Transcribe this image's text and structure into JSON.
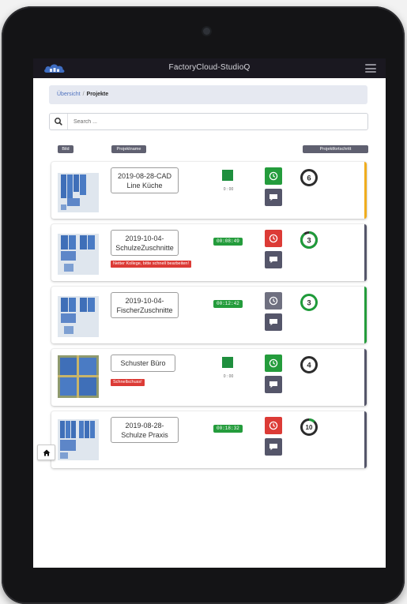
{
  "app": {
    "title": "FactoryCloud-StudioQ"
  },
  "breadcrumb": {
    "overview": "Übersicht",
    "separator": "/",
    "current": "Projekte"
  },
  "search": {
    "placeholder": "Search ..."
  },
  "columns": {
    "image": "Bild",
    "project_name": "Projektname",
    "progress": "Projektfortschritt"
  },
  "colors": {
    "green": "#249c3c",
    "red": "#dc3b36",
    "orange": "#f0ad1e",
    "slate": "#55566a",
    "gray": "#6f7080"
  },
  "projects": [
    {
      "name": "2019-08-28-CAD Line Küche",
      "status_mode": "square",
      "status_text": "0 : 00",
      "clock_color": "green",
      "accent": "orange",
      "progress_number": "6",
      "progress_fraction": 0.0,
      "note": ""
    },
    {
      "name": "2019-10-04-SchulzeZuschnitte",
      "status_mode": "timer",
      "timer": "00:08:49",
      "clock_color": "red",
      "accent": "slate",
      "progress_number": "3",
      "progress_fraction": 0.85,
      "note": "Netter Kollege, bitte schnell bearbeiten!"
    },
    {
      "name": "2019-10-04-FischerZuschnitte",
      "status_mode": "timer",
      "timer": "00:12:42",
      "clock_color": "gray",
      "accent": "green",
      "progress_number": "3",
      "progress_fraction": 1.0,
      "note": ""
    },
    {
      "name": "Schuster Büro",
      "status_mode": "square",
      "status_text": "0 : 00",
      "clock_color": "green",
      "accent": "slate",
      "progress_number": "4",
      "progress_fraction": 0.0,
      "note": "Schnellschuss!"
    },
    {
      "name": "2019-08-28-Schulze Praxis",
      "status_mode": "timer",
      "timer": "00:18:32",
      "clock_color": "red",
      "accent": "slate",
      "progress_number": "10",
      "progress_fraction": 0.12,
      "note": ""
    }
  ],
  "icons": {
    "logo": "cloud-logo",
    "menu": "hamburger-icon",
    "search": "search-icon",
    "clock": "clock-icon",
    "chat": "chat-icon",
    "home": "home-icon"
  }
}
